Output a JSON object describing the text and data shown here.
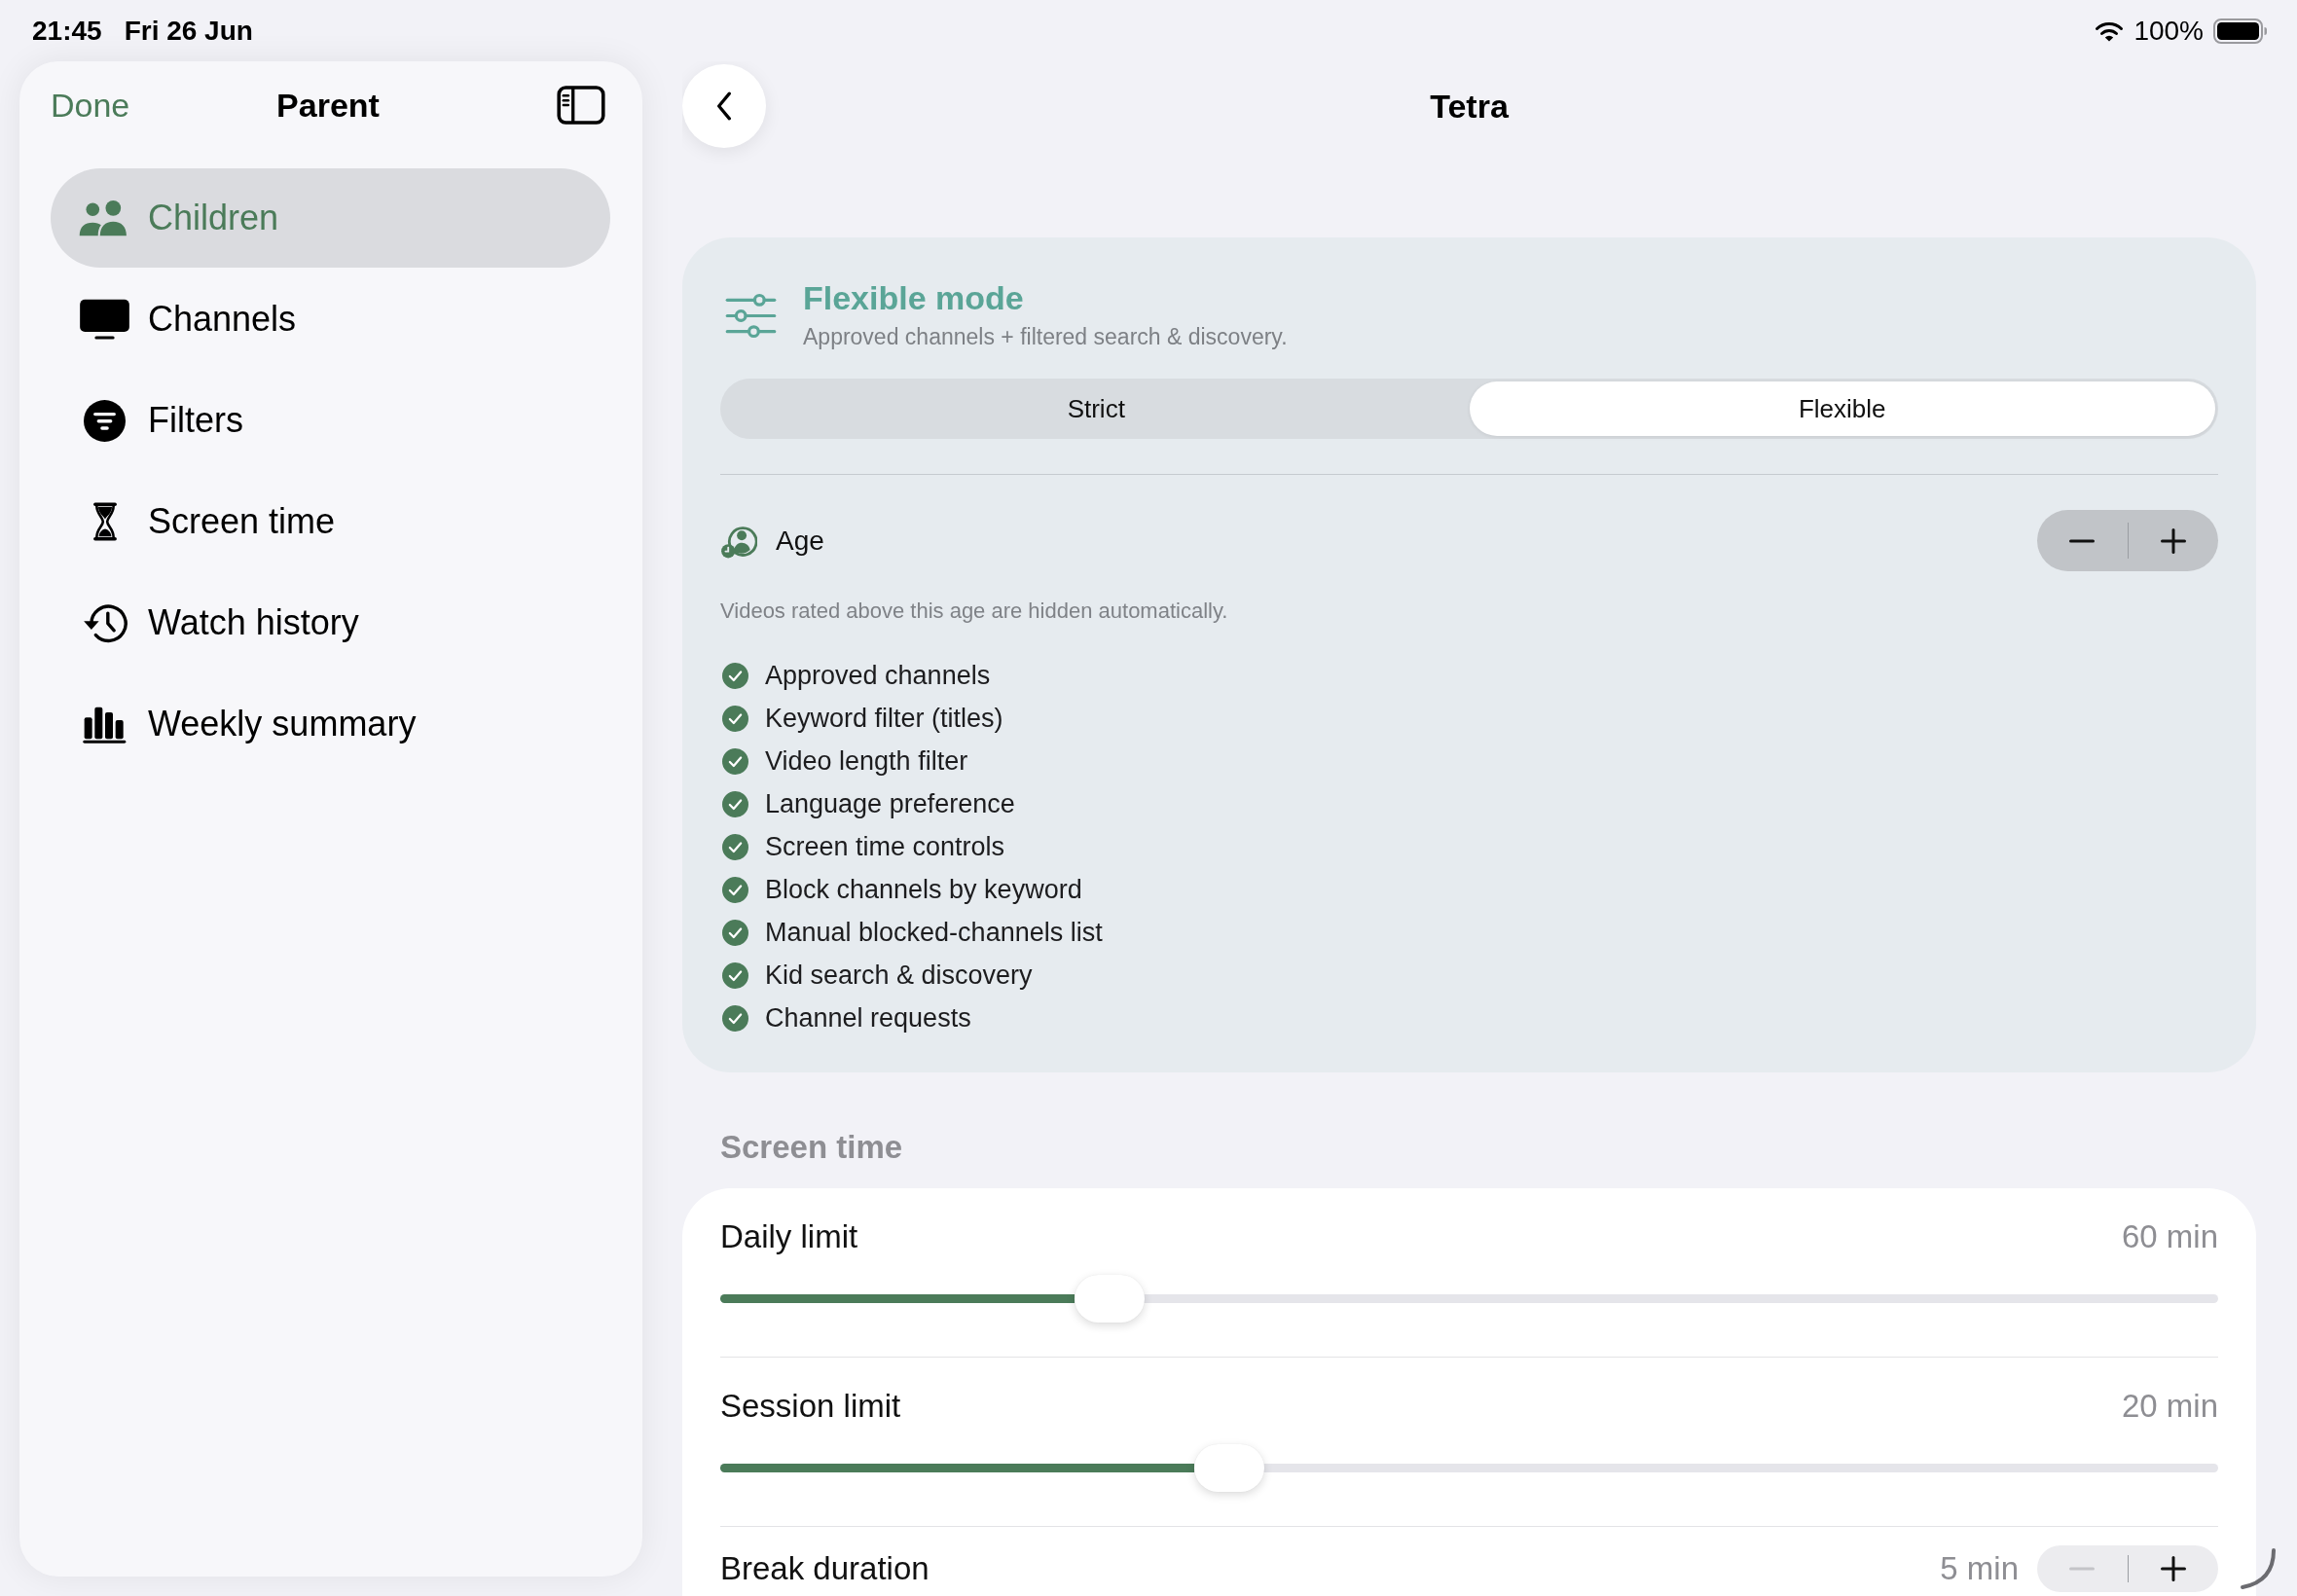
{
  "status_bar": {
    "time": "21:45",
    "date": "Fri 26 Jun",
    "battery": "100%"
  },
  "sidebar": {
    "done_button": "Done",
    "title": "Parent",
    "items": [
      {
        "label": "Children",
        "selected": true
      },
      {
        "label": "Channels",
        "selected": false
      },
      {
        "label": "Filters",
        "selected": false
      },
      {
        "label": "Screen time",
        "selected": false
      },
      {
        "label": "Watch history",
        "selected": false
      },
      {
        "label": "Weekly summary",
        "selected": false
      }
    ]
  },
  "detail": {
    "title": "Tetra",
    "mode_card": {
      "title": "Flexible mode",
      "subtitle": "Approved channels + filtered search & discovery.",
      "segments": [
        {
          "label": "Strict",
          "selected": false
        },
        {
          "label": "Flexible",
          "selected": true
        }
      ],
      "age": {
        "label": "Age",
        "hint": "Videos rated above this age are hidden automatically.",
        "decrement": {
          "disabled": false
        },
        "increment": {
          "disabled": false
        }
      },
      "features": [
        {
          "label": "Approved channels",
          "checked": true
        },
        {
          "label": "Keyword filter (titles)",
          "checked": true
        },
        {
          "label": "Video length filter",
          "checked": true
        },
        {
          "label": "Language preference",
          "checked": true
        },
        {
          "label": "Screen time controls",
          "checked": true
        },
        {
          "label": "Block channels by keyword",
          "checked": true
        },
        {
          "label": "Manual blocked-channels list",
          "checked": true
        },
        {
          "label": "Kid search & discovery",
          "checked": true
        },
        {
          "label": "Channel requests",
          "checked": true
        }
      ]
    },
    "screen_time": {
      "heading": "Screen time",
      "rows": [
        {
          "kind": "slider",
          "label": "Daily limit",
          "value": "60 min",
          "level": 0.26
        },
        {
          "kind": "slider",
          "label": "Session limit",
          "value": "20 min",
          "level": 0.34
        },
        {
          "kind": "stepper",
          "label": "Break duration",
          "value": "5 min",
          "decrement": {
            "disabled": true
          },
          "increment": {
            "disabled": false
          }
        }
      ]
    }
  }
}
